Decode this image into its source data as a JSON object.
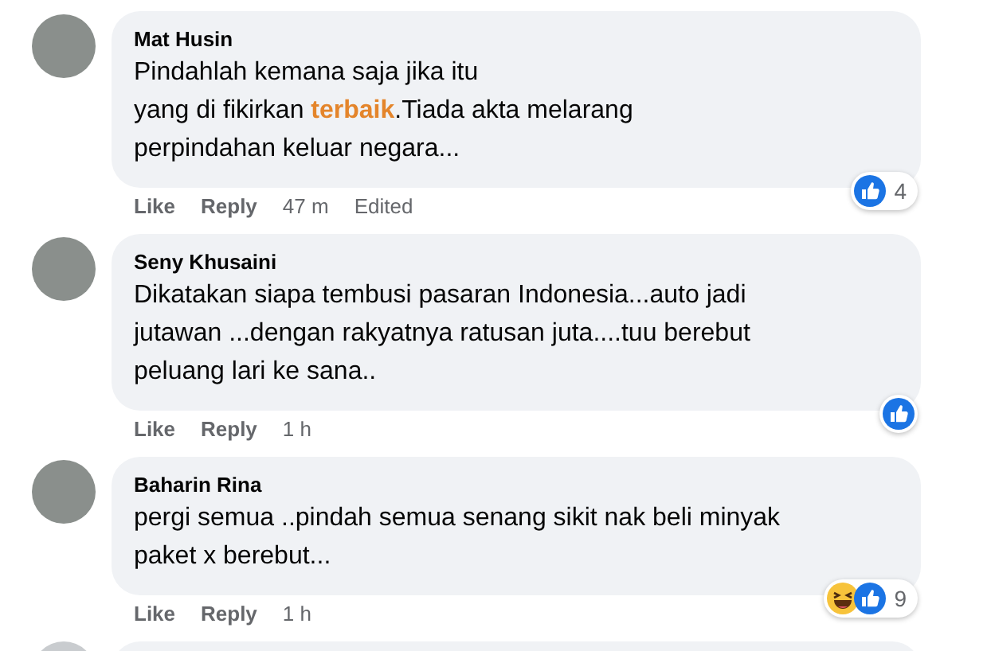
{
  "comments": [
    {
      "author": "Mat Husin",
      "text": "Pindahlah kemana saja jika itu\nyang di fikirkan **terbaik**.Tiada akta melarang\nperpindahan keluar negara...",
      "actions": [
        "Like",
        "Reply"
      ],
      "time": "47 m",
      "edited": "Edited",
      "reactions": [
        {
          "kind": "like"
        }
      ],
      "reaction_count": "4"
    },
    {
      "author": "Seny Khusaini",
      "text": "Dikatakan siapa tembusi pasaran Indonesia...auto jadi\njutawan ...dengan rakyatnya ratusan juta....tuu berebut\npeluang lari ke sana..",
      "actions": [
        "Like",
        "Reply"
      ],
      "time": "1 h",
      "reactions": [
        {
          "kind": "like"
        }
      ]
    },
    {
      "author": "Baharin Rina",
      "text": "pergi semua ..pindah semua senang sikit nak beli minyak\npaket x berebut...",
      "actions": [
        "Like",
        "Reply"
      ],
      "time": "1 h",
      "reactions": [
        {
          "kind": "haha"
        },
        {
          "kind": "like"
        }
      ],
      "reaction_count": "9"
    }
  ]
}
